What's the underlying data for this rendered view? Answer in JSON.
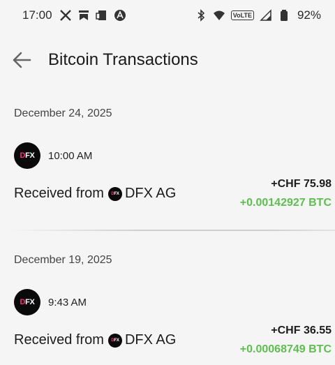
{
  "status_bar": {
    "time": "17:00",
    "volte": "VoLTE",
    "battery": "92%"
  },
  "header": {
    "title": "Bitcoin Transactions"
  },
  "transactions": [
    {
      "date": "December 24, 2025",
      "time": "10:00 AM",
      "logo_text": "DFX",
      "received_from": "Received from",
      "counterparty": "DFX AG",
      "fiat_amount": "+CHF 75.98",
      "btc_amount": "+0.00142927 BTC"
    },
    {
      "date": "December 19, 2025",
      "time": "9:43 AM",
      "logo_text": "DFX",
      "received_from": "Received from",
      "counterparty": "DFX AG",
      "fiat_amount": "+CHF 36.55",
      "btc_amount": "+0.00068749 BTC"
    }
  ],
  "colors": {
    "background": "#f5f5f5",
    "btc_positive": "#5cbf4e",
    "logo_bg": "#0a0a0a",
    "logo_accent": "#ff2d7a"
  },
  "icons": [
    "x-icon",
    "bookmark-icon",
    "calendar-icon",
    "app-icon",
    "bluetooth-icon",
    "wifi-icon",
    "signal-icon",
    "battery-icon",
    "arrow-left-icon"
  ]
}
